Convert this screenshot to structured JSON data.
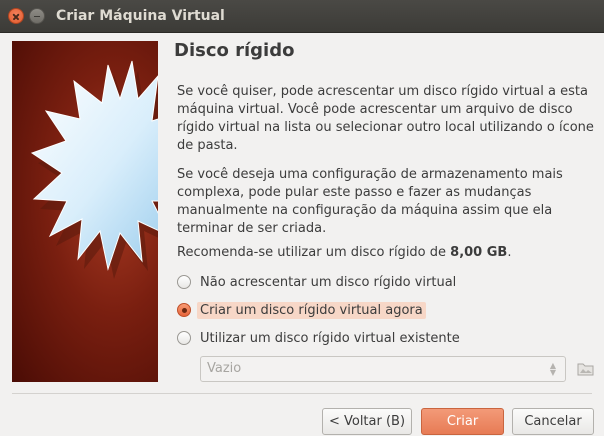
{
  "window": {
    "title": "Criar Máquina Virtual"
  },
  "page": {
    "heading": "Disco rígido",
    "paragraph1": "Se você quiser, pode acrescentar um disco rígido virtual a esta máquina virtual. Você pode acrescentar um arquivo de disco rígido virtual na lista ou selecionar outro local utilizando o ícone de pasta.",
    "paragraph2": "Se você deseja uma configuração de armazenamento mais complexa, pode pular este passo e fazer as mudanças manualmente na configuração da máquina assim que ela terminar de ser criada.",
    "recommend_prefix": "Recomenda-se utilizar um disco rígido de ",
    "recommend_size": "8,00 GB",
    "recommend_suffix": "."
  },
  "options": [
    {
      "label": "Não acrescentar um disco rígido virtual",
      "checked": false
    },
    {
      "label": "Criar um disco rígido virtual agora",
      "checked": true
    },
    {
      "label": "Utilizar um disco rígido virtual existente",
      "checked": false
    }
  ],
  "existing_disk": {
    "selected_value": "Vazio",
    "enabled": false
  },
  "buttons": {
    "back": "< Voltar (B)",
    "create": "Criar",
    "cancel": "Cancelar"
  },
  "colors": {
    "accent": "#e77b55",
    "titlebar": "#3c3b37"
  }
}
